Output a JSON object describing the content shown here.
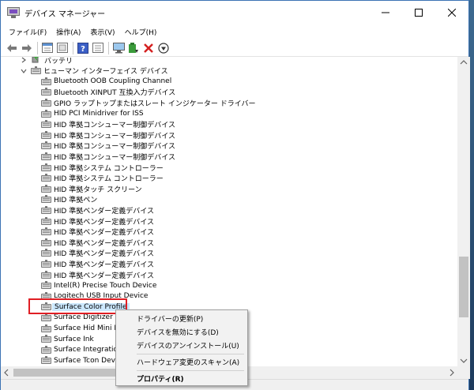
{
  "window": {
    "title": "デバイス マネージャー"
  },
  "menubar": {
    "items": [
      "ファイル(F)",
      "操作(A)",
      "表示(V)",
      "ヘルプ(H)"
    ]
  },
  "toolbar": {
    "icons": [
      "back-arrow-icon",
      "forward-arrow-icon",
      "properties-view-icon",
      "refresh-view-icon",
      "help-icon",
      "details-view-icon",
      "monitor-scan-icon",
      "update-driver-icon",
      "uninstall-x-icon",
      "download-driver-icon"
    ]
  },
  "tree": {
    "battery": "バッテリ",
    "hid_category": "ヒューマン インターフェイス デバイス",
    "devices": [
      "Bluetooth OOB Coupling Channel",
      "Bluetooth XINPUT 互換入力デバイス",
      "GPIO ラップトップまたはスレート インジケーター ドライバー",
      "HID PCI Minidriver for ISS",
      "HID 準拠コンシューマー制御デバイス",
      "HID 準拠コンシューマー制御デバイス",
      "HID 準拠コンシューマー制御デバイス",
      "HID 準拠コンシューマー制御デバイス",
      "HID 準拠システム コントローラー",
      "HID 準拠システム コントローラー",
      "HID 準拠タッチ スクリーン",
      "HID 準拠ペン",
      "HID 準拠ベンダー定義デバイス",
      "HID 準拠ベンダー定義デバイス",
      "HID 準拠ベンダー定義デバイス",
      "HID 準拠ベンダー定義デバイス",
      "HID 準拠ベンダー定義デバイス",
      "HID 準拠ベンダー定義デバイス",
      "HID 準拠ベンダー定義デバイス",
      "Intel(R) Precise Touch Device",
      "Logitech USB Input Device",
      "Surface Color Profile",
      "Surface Digitizer Cor",
      "Surface Hid Mini Dri",
      "Surface Ink",
      "Surface Integration D",
      "Surface Tcon Device"
    ],
    "selected_index": 21
  },
  "context_menu": {
    "update_driver": "ドライバーの更新(P)",
    "disable_device": "デバイスを無効にする(D)",
    "uninstall_device": "デバイスのアンインストール(U)",
    "scan_hardware": "ハードウェア変更のスキャン(A)",
    "properties": "プロパティ(R)"
  }
}
